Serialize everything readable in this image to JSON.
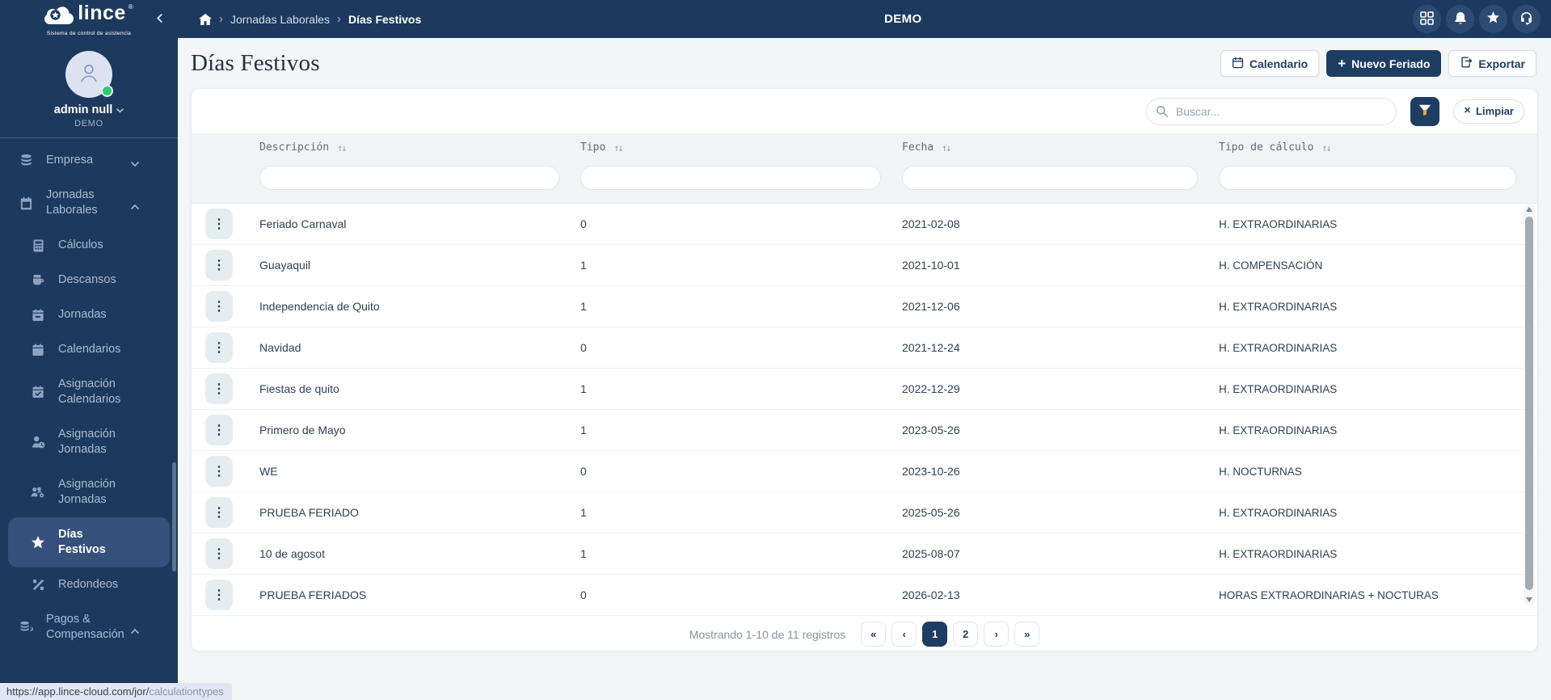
{
  "palette": {
    "brand_navy": "#1d3a5e",
    "button_navy": "#1e3d63",
    "active_item_bg": "#35507b",
    "status_green": "#2ecc71",
    "funnel_amber": "#dfa73f"
  },
  "topbar": {
    "logo": {
      "text": "lince",
      "registered": "®",
      "tagline": "Sistema de control de asistencia"
    },
    "breadcrumb": {
      "items": [
        "Jornadas Laborales",
        "Días Festivos"
      ],
      "separator": "›"
    },
    "environment": "DEMO",
    "icon_names": [
      "apps-grid-icon",
      "notifications-bell-icon",
      "favorites-star-icon",
      "support-headset-icon"
    ]
  },
  "sidebar": {
    "user": {
      "name": "admin null",
      "company": "DEMO"
    },
    "menu": [
      {
        "label": "Empresa",
        "icon": "database-icon",
        "chevron": "down"
      },
      {
        "label": "Jornadas Laborales",
        "icon": "calendar-icon",
        "chevron": "up"
      },
      {
        "label": "Cálculos",
        "icon": "calculator-icon"
      },
      {
        "label": "Descansos",
        "icon": "coffee-cup-icon"
      },
      {
        "label": "Jornadas",
        "icon": "calendar-day-icon"
      },
      {
        "label": "Calendarios",
        "icon": "calendar-solid-icon"
      },
      {
        "label": "Asignación Calendarios",
        "icon": "calendar-check-icon"
      },
      {
        "label": "Asignación Jornadas",
        "icon": "user-clock-icon"
      },
      {
        "label": "Asignación Jornadas",
        "icon": "users-gear-icon"
      },
      {
        "label": "Días Festivos",
        "icon": "star-icon",
        "active": true
      },
      {
        "label": "Redondeos",
        "icon": "percent-icon"
      },
      {
        "label": "Pagos & Compensación",
        "icon": "coins-icon",
        "chevron": "up"
      }
    ]
  },
  "page": {
    "title": "Días Festivos",
    "actions": {
      "calendar": "Calendario",
      "new_plus": "+",
      "new": "Nuevo Feriado",
      "export": "Exportar"
    }
  },
  "toolbar": {
    "search_placeholder": "Buscar...",
    "clear_x": "✕",
    "clear": "Limpiar"
  },
  "table": {
    "kebab": "⋮",
    "headers": [
      {
        "label": "Descripción",
        "sort": "↑↓"
      },
      {
        "label": "Tipo",
        "sort": "↑↓"
      },
      {
        "label": "Fecha",
        "sort": "↑↓"
      },
      {
        "label": "Tipo de cálculo",
        "sort": "↑↓"
      }
    ],
    "rows": [
      {
        "descripcion": "Feriado Carnaval",
        "tipo": "0",
        "fecha": "2021-02-08",
        "tipo_calculo": "H. EXTRAORDINARIAS"
      },
      {
        "descripcion": "Guayaquil",
        "tipo": "1",
        "fecha": "2021-10-01",
        "tipo_calculo": "H. COMPENSACIÓN"
      },
      {
        "descripcion": "Independencia de Quito",
        "tipo": "1",
        "fecha": "2021-12-06",
        "tipo_calculo": "H. EXTRAORDINARIAS"
      },
      {
        "descripcion": "Navidad",
        "tipo": "0",
        "fecha": "2021-12-24",
        "tipo_calculo": "H. EXTRAORDINARIAS"
      },
      {
        "descripcion": "Fiestas de quito",
        "tipo": "1",
        "fecha": "2022-12-29",
        "tipo_calculo": "H. EXTRAORDINARIAS"
      },
      {
        "descripcion": "Primero de Mayo",
        "tipo": "1",
        "fecha": "2023-05-26",
        "tipo_calculo": "H. EXTRAORDINARIAS"
      },
      {
        "descripcion": "WE",
        "tipo": "0",
        "fecha": "2023-10-26",
        "tipo_calculo": "H. NOCTURNAS"
      },
      {
        "descripcion": "PRUEBA FERIADO",
        "tipo": "1",
        "fecha": "2025-05-26",
        "tipo_calculo": "H. EXTRAORDINARIAS"
      },
      {
        "descripcion": "10 de agosot",
        "tipo": "1",
        "fecha": "2025-08-07",
        "tipo_calculo": "H. EXTRAORDINARIAS"
      },
      {
        "descripcion": "PRUEBA FERIADOS",
        "tipo": "0",
        "fecha": "2026-02-13",
        "tipo_calculo": "HORAS EXTRAORDINARIAS + NOCTURAS"
      }
    ]
  },
  "pagination": {
    "summary": "Mostrando 1-10 de 11 registros",
    "first": "«",
    "prev": "‹",
    "next": "›",
    "last": "»",
    "pages": [
      "1",
      "2"
    ],
    "active_page": "1"
  },
  "statusbar": {
    "url_prefix": "https://app.lince-cloud.com/jor/",
    "url_suffix": "calculationtypes"
  }
}
